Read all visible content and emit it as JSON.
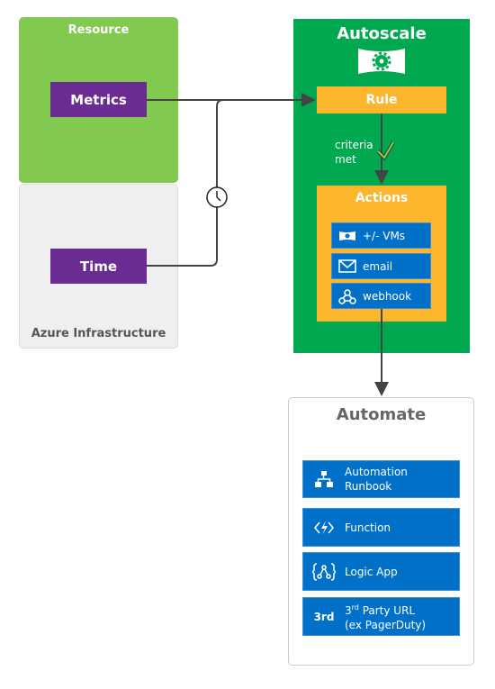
{
  "resource": {
    "title": "Resource",
    "metrics": "Metrics"
  },
  "infrastructure": {
    "title": "Azure Infrastructure",
    "time": "Time"
  },
  "autoscale": {
    "title": "Autoscale",
    "rule": "Rule",
    "criteria": "criteria",
    "met": "met",
    "actions_title": "Actions",
    "actions": [
      {
        "label": "+/- VMs",
        "icon": "vm-icon"
      },
      {
        "label": "email",
        "icon": "email-icon"
      },
      {
        "label": "webhook",
        "icon": "webhook-icon"
      }
    ]
  },
  "automate": {
    "title": "Automate",
    "items": [
      {
        "line1": "Automation",
        "line2": "Runbook",
        "icon": "hierarchy-icon"
      },
      {
        "line1": "Function",
        "icon": "function-icon"
      },
      {
        "line1": "Logic App",
        "icon": "logic-app-icon"
      },
      {
        "badge": "3rd",
        "sup_base": "3",
        "sup": "rd",
        "line1_rest": " Party URL",
        "line2": "(ex PagerDuty)"
      }
    ]
  },
  "colors": {
    "resource": "#82c94f",
    "autoscale": "#00a84f",
    "purple": "#6a2c93",
    "orange": "#fbb62d",
    "blue": "#0070c8",
    "infra": "#efefef"
  }
}
